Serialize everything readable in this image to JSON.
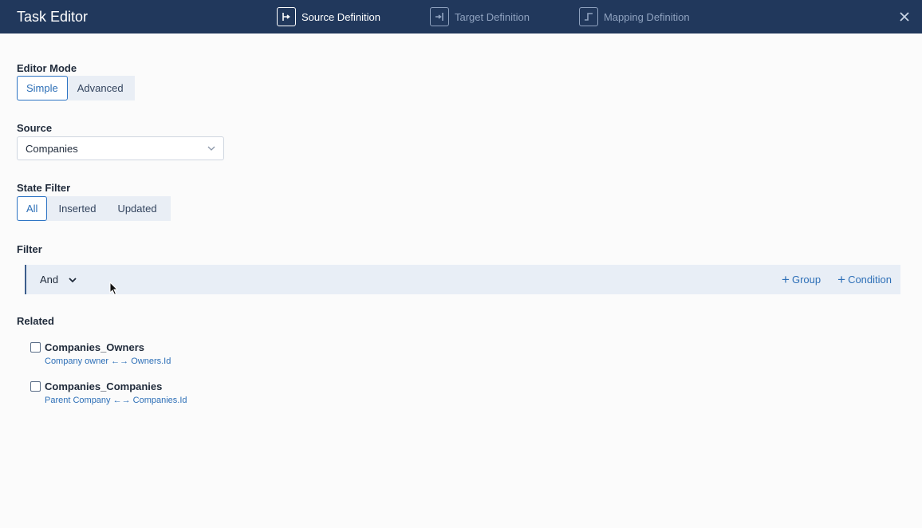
{
  "header": {
    "title": "Task Editor",
    "steps": [
      {
        "label": "Source Definition",
        "icon": "source-definition-icon",
        "active": true
      },
      {
        "label": "Target Definition",
        "icon": "target-definition-icon",
        "active": false
      },
      {
        "label": "Mapping Definition",
        "icon": "mapping-definition-icon",
        "active": false
      }
    ],
    "close_icon": "close-icon"
  },
  "editor_mode": {
    "label": "Editor Mode",
    "options": [
      "Simple",
      "Advanced"
    ],
    "selected": "Simple"
  },
  "source": {
    "label": "Source",
    "value": "Companies"
  },
  "state_filter": {
    "label": "State Filter",
    "options": [
      "All",
      "Inserted",
      "Updated"
    ],
    "selected": "All"
  },
  "filter": {
    "label": "Filter",
    "operator": "And",
    "add_group": "Group",
    "add_condition": "Condition"
  },
  "related": {
    "label": "Related",
    "items": [
      {
        "name": "Companies_Owners",
        "description": "Company owner ←→ Owners.Id",
        "checked": false
      },
      {
        "name": "Companies_Companies",
        "description": "Parent Company ←→ Companies.Id",
        "checked": false
      }
    ]
  },
  "colors": {
    "header_bg": "#21385c",
    "accent": "#2d6fb7"
  }
}
